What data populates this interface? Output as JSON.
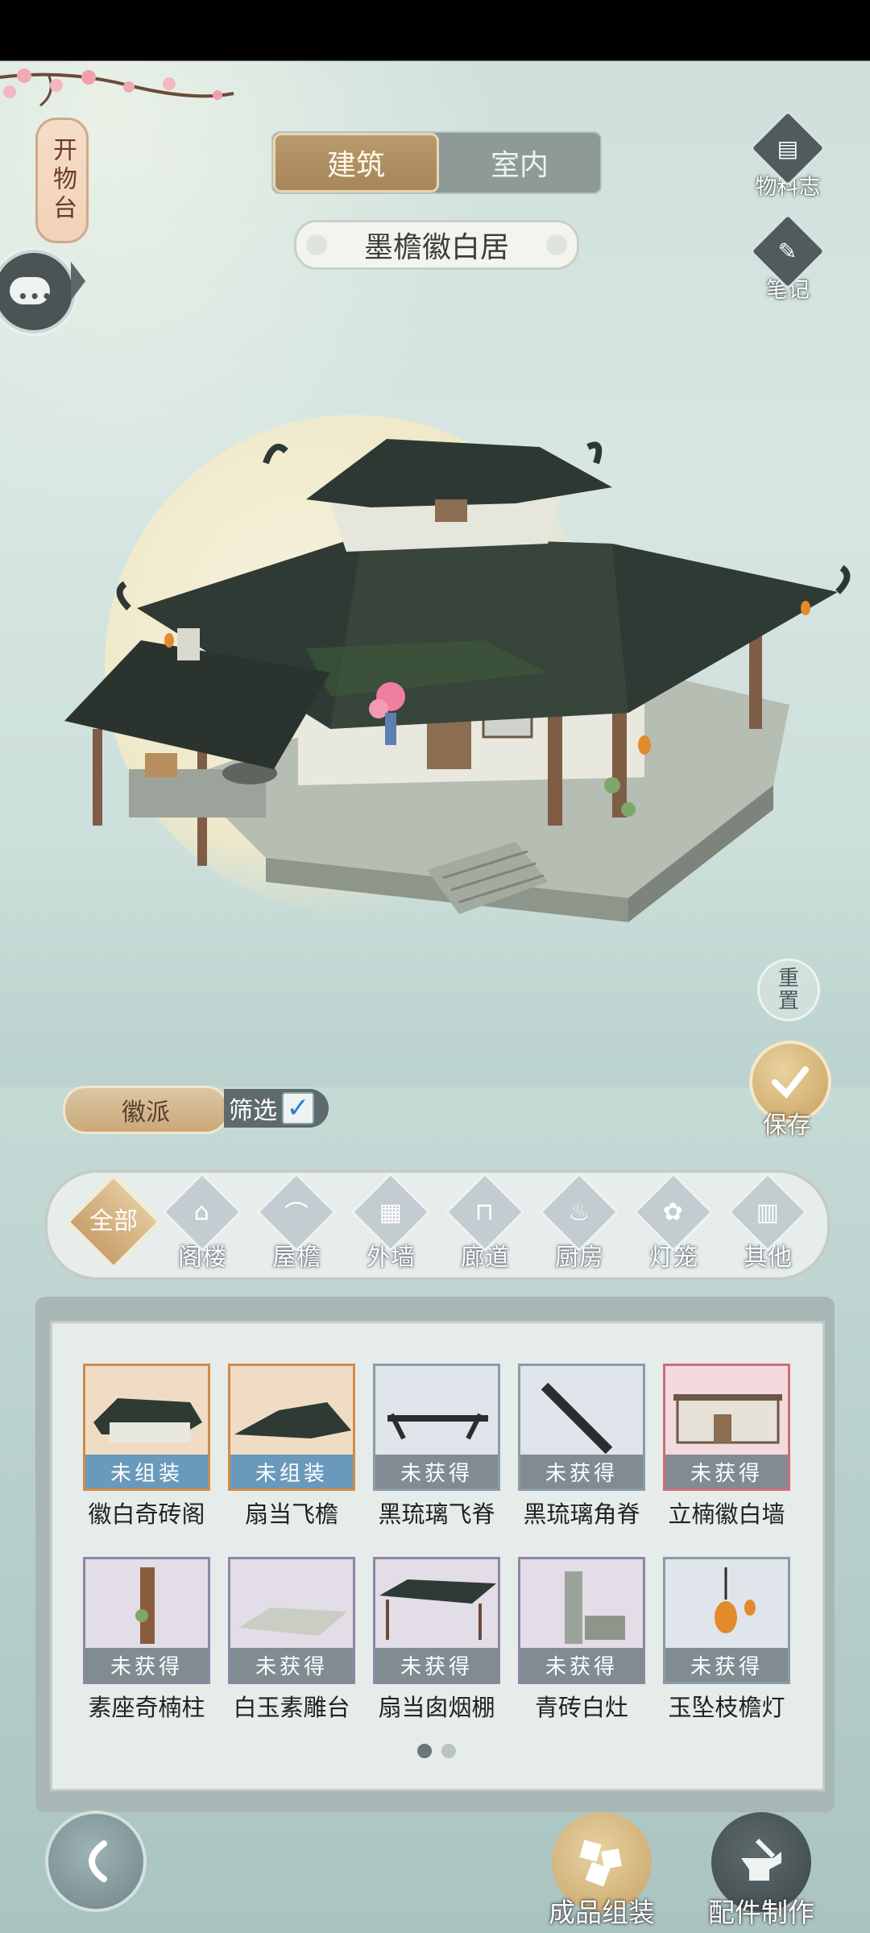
{
  "side": {
    "kaiwutai": "开物台"
  },
  "tabs": [
    {
      "label": "建筑",
      "active": true
    },
    {
      "label": "室内",
      "active": false
    }
  ],
  "building_name": "墨檐徽白居",
  "right_icons": [
    {
      "label": "物料志",
      "icon": "book-icon"
    },
    {
      "label": "笔记",
      "icon": "note-icon"
    }
  ],
  "reset_label": "重置",
  "save_label": "保存",
  "style_filter": {
    "style": "徽派",
    "filter_label": "筛选",
    "checked": true
  },
  "categories": [
    {
      "label": "全部",
      "active": true
    },
    {
      "label": "阁楼"
    },
    {
      "label": "屋檐"
    },
    {
      "label": "外墙"
    },
    {
      "label": "廊道"
    },
    {
      "label": "厨房"
    },
    {
      "label": "灯笼"
    },
    {
      "label": "其他"
    }
  ],
  "items": [
    {
      "name": "徽白奇砖阁",
      "status": "未组装",
      "rarity": "orange"
    },
    {
      "name": "扇当飞檐",
      "status": "未组装",
      "rarity": "orange"
    },
    {
      "name": "黑琉璃飞脊",
      "status": "未获得",
      "rarity": "blue"
    },
    {
      "name": "黑琉璃角脊",
      "status": "未获得",
      "rarity": "blue"
    },
    {
      "name": "立楠徽白墙",
      "status": "未获得",
      "rarity": "red"
    },
    {
      "name": "素座奇楠柱",
      "status": "未获得",
      "rarity": "purple"
    },
    {
      "name": "白玉素雕台",
      "status": "未获得",
      "rarity": "purple"
    },
    {
      "name": "扇当囱烟棚",
      "status": "未获得",
      "rarity": "purple"
    },
    {
      "name": "青砖白灶",
      "status": "未获得",
      "rarity": "purple"
    },
    {
      "name": "玉坠枝檐灯",
      "status": "未获得",
      "rarity": "blue"
    }
  ],
  "pager": {
    "total": 2,
    "current": 1
  },
  "bottom": {
    "assemble_label": "成品组装",
    "craft_label": "配件制作"
  },
  "colors": {
    "accent_gold": "#b89a6d",
    "panel_bg": "#e6ecea",
    "orange_frame": "#d08b4b",
    "red_frame": "#d06c78"
  }
}
